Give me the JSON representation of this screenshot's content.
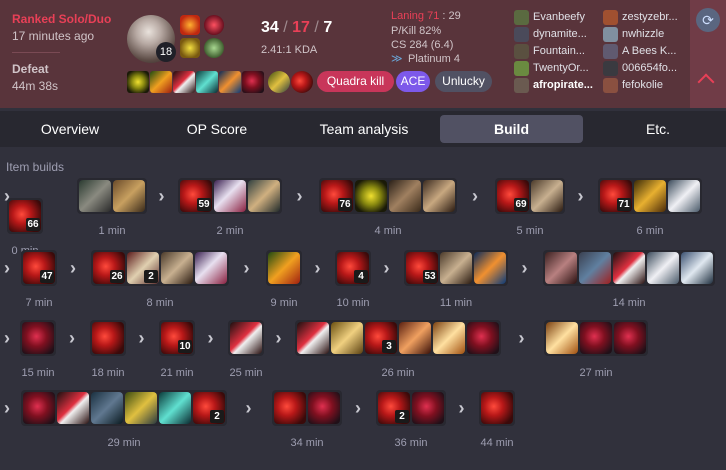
{
  "match": {
    "queue": "Ranked Solo/Duo",
    "time_ago": "17 minutes ago",
    "result": "Defeat",
    "duration": "44m 38s"
  },
  "champion": {
    "level": "18"
  },
  "kda": {
    "kills": "34",
    "sep1": "/",
    "deaths": "17",
    "sep2": "/",
    "assists": "7",
    "ratio": "2.41:1 KDA"
  },
  "stats": {
    "laning_label": "Laning 71",
    "laning_value": ": 29",
    "pkill": "P/Kill 82%",
    "cs": "CS 284 (6.4)",
    "rank": "Platinum 4"
  },
  "badges": [
    {
      "label": "Quadra kill",
      "color": "#c8365a"
    },
    {
      "label": "ACE",
      "color": "#7d59ea"
    },
    {
      "label": "Unlucky",
      "color": "#515163"
    }
  ],
  "team1": [
    "Evanbeefy",
    "dynamite...",
    "Fountain...",
    "TwentyOr...",
    "afropirate..."
  ],
  "team2": [
    "zestyzebr...",
    "nwhizzle",
    "A Bees K...",
    "006654fo...",
    "fefokolie"
  ],
  "tabs": [
    "Overview",
    "OP Score",
    "Team analysis",
    "Build",
    "Etc."
  ],
  "section_title": "Item builds",
  "colors": {
    "header_bg": "#59343b",
    "loss_red": "#e84057",
    "bg": "#31313c",
    "tab_active": "#515163"
  },
  "icons": {
    "expand": "chevron-up-icon",
    "side": "refresh-icon",
    "rank": "wings-icon"
  },
  "timeline": [
    {
      "label": "0 min",
      "items": [
        {
          "n": "fracture-item-icon",
          "c": "66"
        }
      ]
    },
    {
      "label": "1 min",
      "items": [
        {
          "n": "pickaxe-icon"
        },
        {
          "n": "hammer-icon"
        }
      ]
    },
    {
      "label": "2 min",
      "items": [
        {
          "n": "fracture-item-icon",
          "c": "59"
        },
        {
          "n": "scythe-icon"
        },
        {
          "n": "sword-icon"
        }
      ]
    },
    {
      "label": "4 min",
      "items": [
        {
          "n": "fracture-item-icon",
          "c": "76"
        },
        {
          "n": "ward-icon"
        },
        {
          "n": "boots-icon"
        },
        {
          "n": "cloth-armor-icon"
        }
      ]
    },
    {
      "label": "5 min",
      "items": [
        {
          "n": "fracture-item-icon",
          "c": "69"
        },
        {
          "n": "gauntlet-icon"
        }
      ]
    },
    {
      "label": "6 min",
      "items": [
        {
          "n": "fracture-item-icon",
          "c": "71"
        },
        {
          "n": "helmet-icon"
        },
        {
          "n": "cape-icon"
        }
      ]
    },
    {
      "label": "7 min",
      "items": [
        {
          "n": "fracture-item-icon",
          "c": "47"
        }
      ]
    },
    {
      "label": "8 min",
      "items": [
        {
          "n": "fracture-item-icon",
          "c": "26"
        },
        {
          "n": "potion-icon",
          "c": "2"
        },
        {
          "n": "gauntlet-icon"
        },
        {
          "n": "scythe-icon"
        }
      ]
    },
    {
      "label": "9 min",
      "items": [
        {
          "n": "blade-green-icon"
        }
      ]
    },
    {
      "label": "10 min",
      "items": [
        {
          "n": "fracture-item-icon",
          "c": "4"
        }
      ]
    },
    {
      "label": "11 min",
      "items": [
        {
          "n": "fracture-item-icon",
          "c": "53"
        },
        {
          "n": "gauntlet-icon"
        },
        {
          "n": "bow-icon"
        }
      ]
    },
    {
      "label": "14 min",
      "items": [
        {
          "n": "fist-icon"
        },
        {
          "n": "shard-icon"
        },
        {
          "n": "cleaver-icon"
        },
        {
          "n": "cape-icon"
        },
        {
          "n": "mask-icon"
        }
      ]
    },
    {
      "label": "15 min",
      "items": [
        {
          "n": "axe-red-icon"
        }
      ]
    },
    {
      "label": "18 min",
      "items": [
        {
          "n": "fracture-item-icon"
        }
      ]
    },
    {
      "label": "21 min",
      "items": [
        {
          "n": "fracture-item-icon",
          "c": "10"
        }
      ]
    },
    {
      "label": "25 min",
      "items": [
        {
          "n": "cleaver-icon"
        }
      ]
    },
    {
      "label": "26 min",
      "items": [
        {
          "n": "cleaver-icon"
        },
        {
          "n": "scroll-icon"
        },
        {
          "n": "fracture-item-icon",
          "c": "3"
        },
        {
          "n": "crossbow-icon"
        },
        {
          "n": "wings-item-icon"
        },
        {
          "n": "axe-red-icon"
        }
      ]
    },
    {
      "label": "27 min",
      "items": [
        {
          "n": "wings-item-icon"
        },
        {
          "n": "axe-red-icon"
        },
        {
          "n": "axe-red-icon"
        }
      ]
    },
    {
      "label": "29 min",
      "items": [
        {
          "n": "axe-red-icon"
        },
        {
          "n": "cleaver-icon"
        },
        {
          "n": "hood-icon"
        },
        {
          "n": "orb-gold-icon"
        },
        {
          "n": "claw-teal-icon"
        },
        {
          "n": "fracture-item-icon",
          "c": "2"
        }
      ]
    },
    {
      "label": "34 min",
      "items": [
        {
          "n": "fracture-item-icon"
        },
        {
          "n": "axe-red-icon"
        }
      ]
    },
    {
      "label": "36 min",
      "items": [
        {
          "n": "fracture-item-icon",
          "c": "2"
        },
        {
          "n": "axe-red-icon"
        }
      ]
    },
    {
      "label": "44 min",
      "items": [
        {
          "n": "fracture-item-icon"
        }
      ]
    }
  ]
}
